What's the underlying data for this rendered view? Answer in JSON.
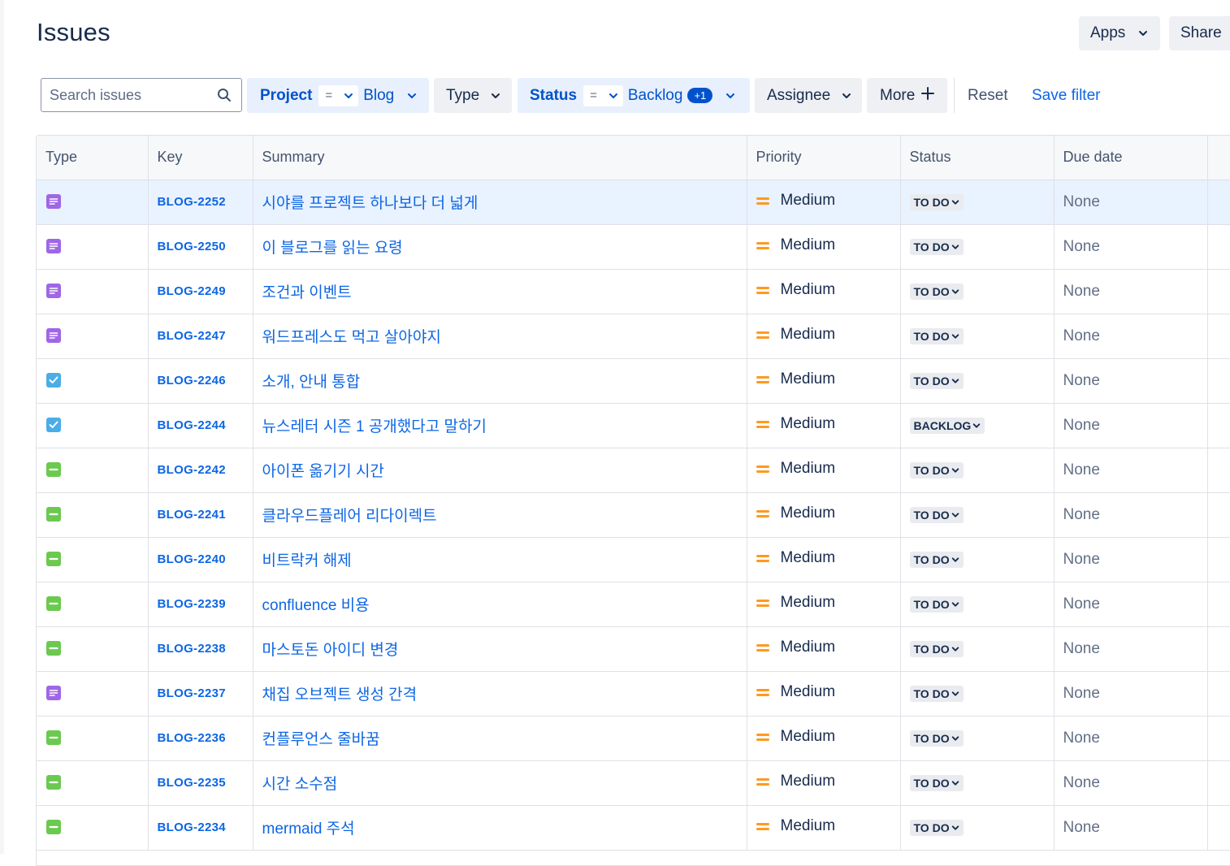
{
  "page": {
    "title": "Issues"
  },
  "top_buttons": {
    "apps_label": "Apps",
    "share_label": "Share"
  },
  "filters": {
    "search_placeholder": "Search issues",
    "project": {
      "label": "Project",
      "operator": "=",
      "value": "Blog"
    },
    "type": {
      "label": "Type"
    },
    "status": {
      "label": "Status",
      "operator": "=",
      "value": "Backlog",
      "badge": "+1"
    },
    "assignee": {
      "label": "Assignee"
    },
    "more": {
      "label": "More",
      "icon": "plus-icon"
    },
    "reset_label": "Reset",
    "save_filter_label": "Save filter"
  },
  "table": {
    "columns": [
      "Type",
      "Key",
      "Summary",
      "Priority",
      "Status",
      "Due date"
    ],
    "type_colors": {
      "story": "#9f66e6",
      "task": "#4bade8",
      "subtask": "#6bc950"
    },
    "priority_color": "#ff991f",
    "rows": [
      {
        "type": "story",
        "key": "BLOG-2252",
        "summary": "시야를 프로젝트 하나보다 더 넓게",
        "priority": "Medium",
        "status": "TO DO",
        "due": "None",
        "selected": true
      },
      {
        "type": "story",
        "key": "BLOG-2250",
        "summary": "이 블로그를 읽는 요령",
        "priority": "Medium",
        "status": "TO DO",
        "due": "None"
      },
      {
        "type": "story",
        "key": "BLOG-2249",
        "summary": "조건과 이벤트",
        "priority": "Medium",
        "status": "TO DO",
        "due": "None"
      },
      {
        "type": "story",
        "key": "BLOG-2247",
        "summary": "워드프레스도 먹고 살아야지",
        "priority": "Medium",
        "status": "TO DO",
        "due": "None"
      },
      {
        "type": "task",
        "key": "BLOG-2246",
        "summary": "소개, 안내 통합",
        "priority": "Medium",
        "status": "TO DO",
        "due": "None"
      },
      {
        "type": "task",
        "key": "BLOG-2244",
        "summary": "뉴스레터 시즌 1 공개했다고 말하기",
        "priority": "Medium",
        "status": "BACKLOG",
        "due": "None"
      },
      {
        "type": "subtask",
        "key": "BLOG-2242",
        "summary": "아이폰 옮기기 시간",
        "priority": "Medium",
        "status": "TO DO",
        "due": "None"
      },
      {
        "type": "subtask",
        "key": "BLOG-2241",
        "summary": "클라우드플레어 리다이렉트",
        "priority": "Medium",
        "status": "TO DO",
        "due": "None"
      },
      {
        "type": "subtask",
        "key": "BLOG-2240",
        "summary": "비트락커 해제",
        "priority": "Medium",
        "status": "TO DO",
        "due": "None"
      },
      {
        "type": "subtask",
        "key": "BLOG-2239",
        "summary": "confluence 비용",
        "priority": "Medium",
        "status": "TO DO",
        "due": "None"
      },
      {
        "type": "subtask",
        "key": "BLOG-2238",
        "summary": "마스토돈 아이디 변경",
        "priority": "Medium",
        "status": "TO DO",
        "due": "None"
      },
      {
        "type": "story",
        "key": "BLOG-2237",
        "summary": "채집 오브젝트 생성 간격",
        "priority": "Medium",
        "status": "TO DO",
        "due": "None"
      },
      {
        "type": "subtask",
        "key": "BLOG-2236",
        "summary": "컨플루언스 줄바꿈",
        "priority": "Medium",
        "status": "TO DO",
        "due": "None"
      },
      {
        "type": "subtask",
        "key": "BLOG-2235",
        "summary": "시간 소수점",
        "priority": "Medium",
        "status": "TO DO",
        "due": "None"
      },
      {
        "type": "subtask",
        "key": "BLOG-2234",
        "summary": "mermaid 주석",
        "priority": "Medium",
        "status": "TO DO",
        "due": "None"
      }
    ]
  }
}
